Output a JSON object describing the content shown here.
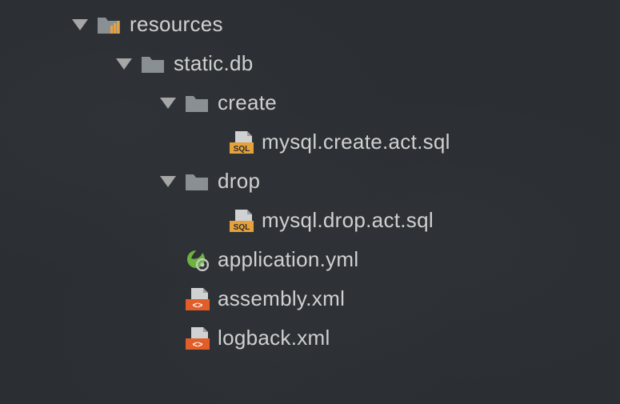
{
  "tree": {
    "resources": {
      "label": "resources",
      "expanded": true,
      "children": {
        "static_db": {
          "label": "static.db",
          "expanded": true,
          "children": {
            "create": {
              "label": "create",
              "expanded": true,
              "children": {
                "mysql_create": {
                  "label": "mysql.create.act.sql"
                }
              }
            },
            "drop": {
              "label": "drop",
              "expanded": true,
              "children": {
                "mysql_drop": {
                  "label": "mysql.drop.act.sql"
                }
              }
            }
          }
        },
        "application_yml": {
          "label": "application.yml"
        },
        "assembly_xml": {
          "label": "assembly.xml"
        },
        "logback_xml": {
          "label": "logback.xml"
        }
      }
    }
  },
  "colors": {
    "folder": "#8a8f94",
    "resources_accent": "#e6a13a",
    "sql_badge": "#e6a13a",
    "xml_badge": "#e15e29",
    "spring": "#6db33f",
    "text": "#d0d0d0",
    "file_page": "#cfd1d3"
  }
}
